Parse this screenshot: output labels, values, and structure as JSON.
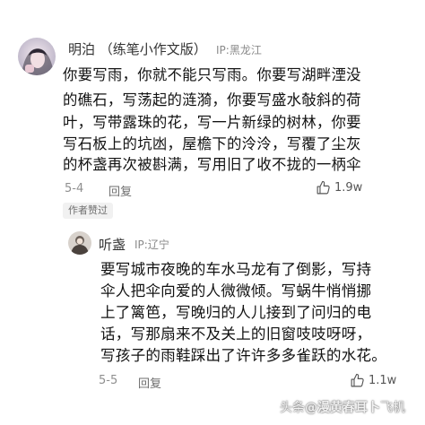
{
  "comment": {
    "author": "明泊 （练笔小作文版）",
    "ip": "IP:黑龙江",
    "lines": [
      "你要写雨，你就不能只写雨。你要写湖畔湮没",
      "的礁石，写荡起的涟漪，你要写盛水敧斜的荷",
      "叶，写带露珠的花，写一片新绿的树林，你要",
      "写石板上的坑凼，屋檐下的泠泠，写覆了尘灰",
      "的杯盏再次被斟满，写用旧了收不拢的一柄伞"
    ],
    "date": "5-4",
    "reply_label": "回复",
    "likes": "1.9w",
    "author_liked": "作者赞过"
  },
  "reply": {
    "author": "听盏",
    "ip": "IP:辽宁",
    "lines": [
      "要写城市夜晚的车水马龙有了倒影，写持",
      "伞人把伞向爱的人微微倾。写蜗牛悄悄挪",
      "上了篱笆，写晚归的人儿接到了问归的电",
      "话，写那扇来不及关上的旧窗吱吱呀呀，",
      "写孩子的雨鞋踩出了许许多多雀跃的水花。"
    ],
    "date": "5-5",
    "reply_label": "回复",
    "likes": "1.1w"
  },
  "watermark": {
    "prefix": "头条",
    "brand": "@漫黄春耳卜",
    "suffix": "飞机"
  },
  "icons": {
    "like": "thumbs-up-icon"
  },
  "colors": {
    "text": "#121212",
    "meta": "#8f8f8f",
    "tag_bg": "#f1f1f1"
  }
}
